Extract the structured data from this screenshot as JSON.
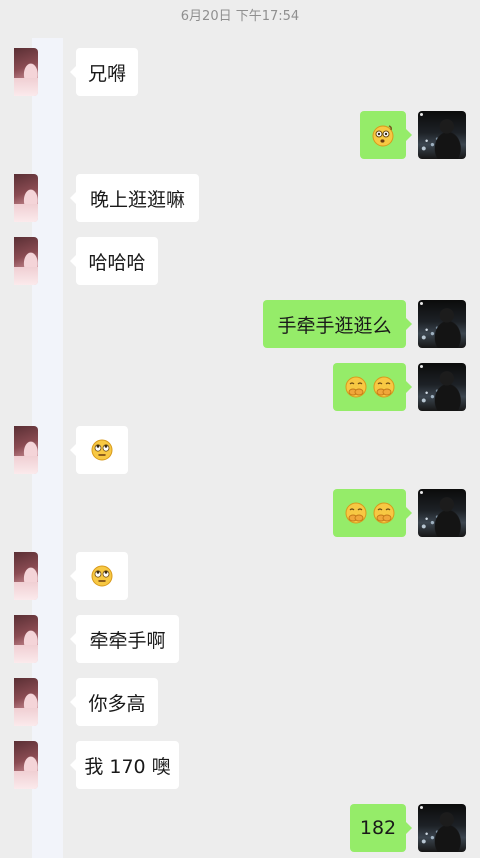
{
  "chat": {
    "timestamp": "6月20日 下午17:54",
    "messages": [
      {
        "side": "left",
        "type": "text",
        "text": "兄嘚"
      },
      {
        "side": "right",
        "type": "emoji",
        "emoji": "dizzy-face-emoji"
      },
      {
        "side": "left",
        "type": "text",
        "text": "晚上逛逛嘛"
      },
      {
        "side": "left",
        "type": "text",
        "text": "哈哈哈"
      },
      {
        "side": "right",
        "type": "text",
        "text": "手牵手逛逛么"
      },
      {
        "side": "right",
        "type": "emoji",
        "emoji": "shy-hands-emoji ×2"
      },
      {
        "side": "left",
        "type": "emoji",
        "emoji": "eye-roll-emoji"
      },
      {
        "side": "right",
        "type": "emoji",
        "emoji": "shy-hands-emoji ×2"
      },
      {
        "side": "left",
        "type": "emoji",
        "emoji": "eye-roll-emoji"
      },
      {
        "side": "left",
        "type": "text",
        "text": "牵牵手啊"
      },
      {
        "side": "left",
        "type": "text",
        "text": "你多高"
      },
      {
        "side": "left",
        "type": "text",
        "text": "我 170 噢"
      },
      {
        "side": "right",
        "type": "text",
        "text": "182"
      }
    ]
  },
  "colors": {
    "background": "#ededed",
    "incoming_bubble": "#ffffff",
    "outgoing_bubble": "#95ec69",
    "timestamp": "#8f8f8f"
  }
}
